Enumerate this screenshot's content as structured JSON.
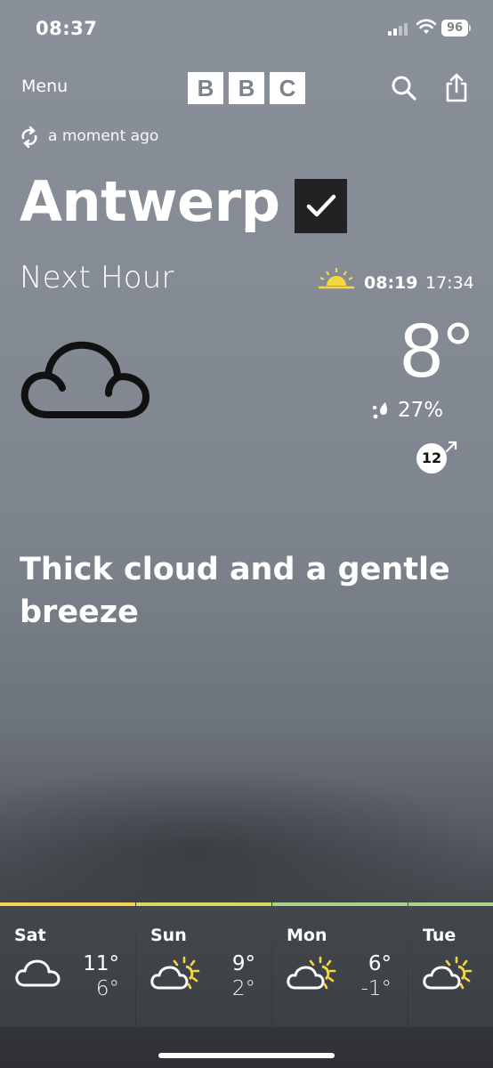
{
  "status_bar": {
    "time": "08:37",
    "battery": "96"
  },
  "header": {
    "menu_label": "Menu",
    "logo_letters": [
      "B",
      "B",
      "C"
    ]
  },
  "updated": "a moment ago",
  "location": {
    "name": "Antwerp"
  },
  "next_hour": {
    "label": "Next Hour",
    "sunrise": "08:19",
    "sunset": "17:34",
    "temperature": "8°",
    "precipitation": "27%",
    "wind_speed": "12",
    "description": "Thick cloud and a gentle breeze",
    "icon": "cloud-icon"
  },
  "forecast": [
    {
      "day": "Sat",
      "high": "11°",
      "low": "6°",
      "icon": "cloud-icon",
      "accent": "#f2d64b"
    },
    {
      "day": "Sun",
      "high": "9°",
      "low": "2°",
      "icon": "sun-cloud-icon",
      "accent": "#d3de5a"
    },
    {
      "day": "Mon",
      "high": "6°",
      "low": "-1°",
      "icon": "sun-cloud-icon",
      "accent": "#a7d38a"
    },
    {
      "day": "Tue",
      "high": "",
      "low": "",
      "icon": "sun-cloud-icon",
      "accent": "#a7d38a"
    }
  ],
  "colors": {
    "sun_yellow": "#f5d742",
    "check_bg": "#222222"
  }
}
